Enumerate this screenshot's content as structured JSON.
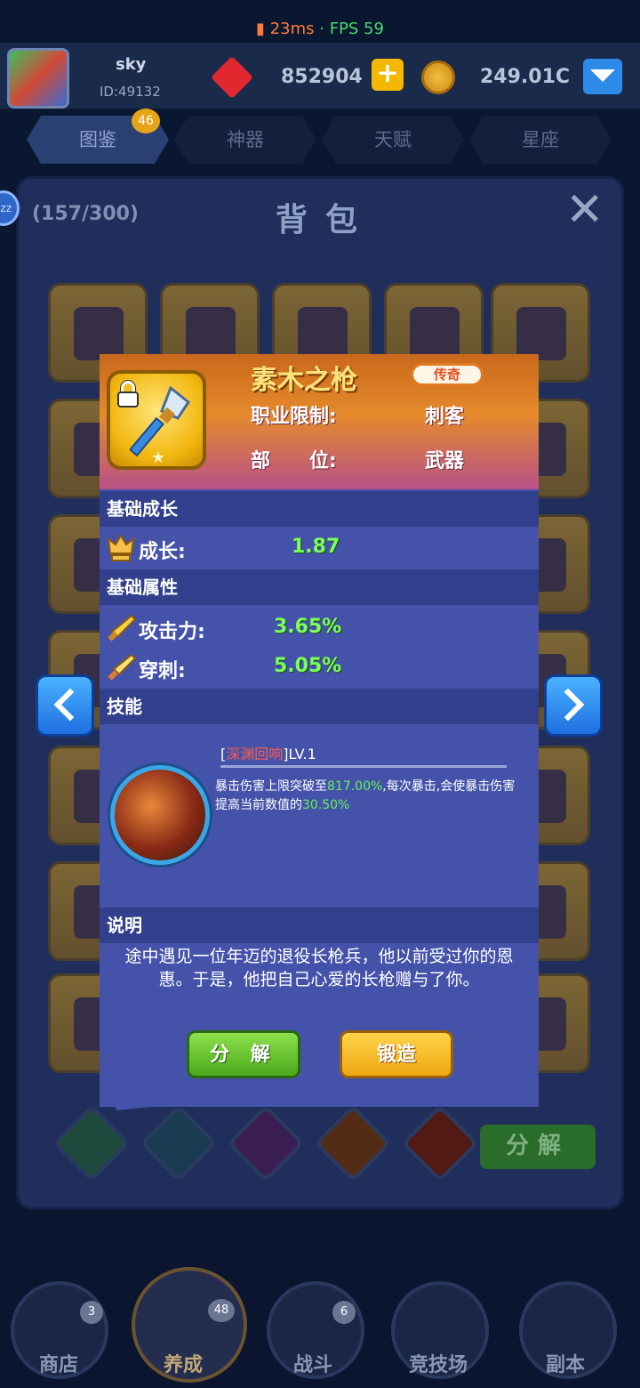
{
  "status": {
    "ping": "23ms",
    "separator": " · ",
    "fps": "FPS 59"
  },
  "player": {
    "name": "sky",
    "id": "ID:49132",
    "gems": "852904",
    "plus": "+",
    "coins": "249.01C"
  },
  "tabs": [
    {
      "label": "图鉴"
    },
    {
      "label": "神器"
    },
    {
      "label": "天赋"
    },
    {
      "label": "星座"
    }
  ],
  "tab_badge": "46",
  "zz_badge": "zz",
  "bag": {
    "count": "(157/300)",
    "title": "背包",
    "close": "✕"
  },
  "bag_decompose": "分解",
  "item": {
    "name": "素木之枪",
    "rarity": "传奇",
    "class_label": "职业限制:",
    "class_value": "刺客",
    "slot_label": "部　　位:",
    "slot_value": "武器",
    "star": "★"
  },
  "sections": {
    "growth": "基础成长",
    "attrs": "基础属性",
    "skill": "技能",
    "desc": "说明"
  },
  "stats": {
    "growth_label": "成长:",
    "growth_value": "1.87",
    "attack_label": "攻击力:",
    "attack_value": "3.65%",
    "pierce_label": "穿刺:",
    "pierce_value": "5.05%"
  },
  "skill": {
    "bracket_open": "[",
    "name": "深渊回响",
    "bracket_close": "]",
    "level": "LV.1",
    "desc_1": "暴击伤害上限突破至",
    "val_1": "817.00%",
    "desc_2": ",每次暴击,会使暴击伤害提高当前数值的",
    "val_2": "30.50%"
  },
  "description": "途中遇见一位年迈的退役长枪兵，他以前受过你的恩惠。于是，他把自己心爱的长枪赠与了你。",
  "buttons": {
    "decompose": "分 解",
    "forge": "锻造"
  },
  "nav": [
    {
      "label": "商店",
      "badge": "3"
    },
    {
      "label": "养成",
      "badge": "48"
    },
    {
      "label": "战斗",
      "badge": "6"
    },
    {
      "label": "竞技场"
    },
    {
      "label": "副本"
    }
  ],
  "colors": {
    "accent_green": "#7cff5a",
    "rarity_orange": "#e07b22",
    "highlight_red": "#ff5a4a"
  }
}
